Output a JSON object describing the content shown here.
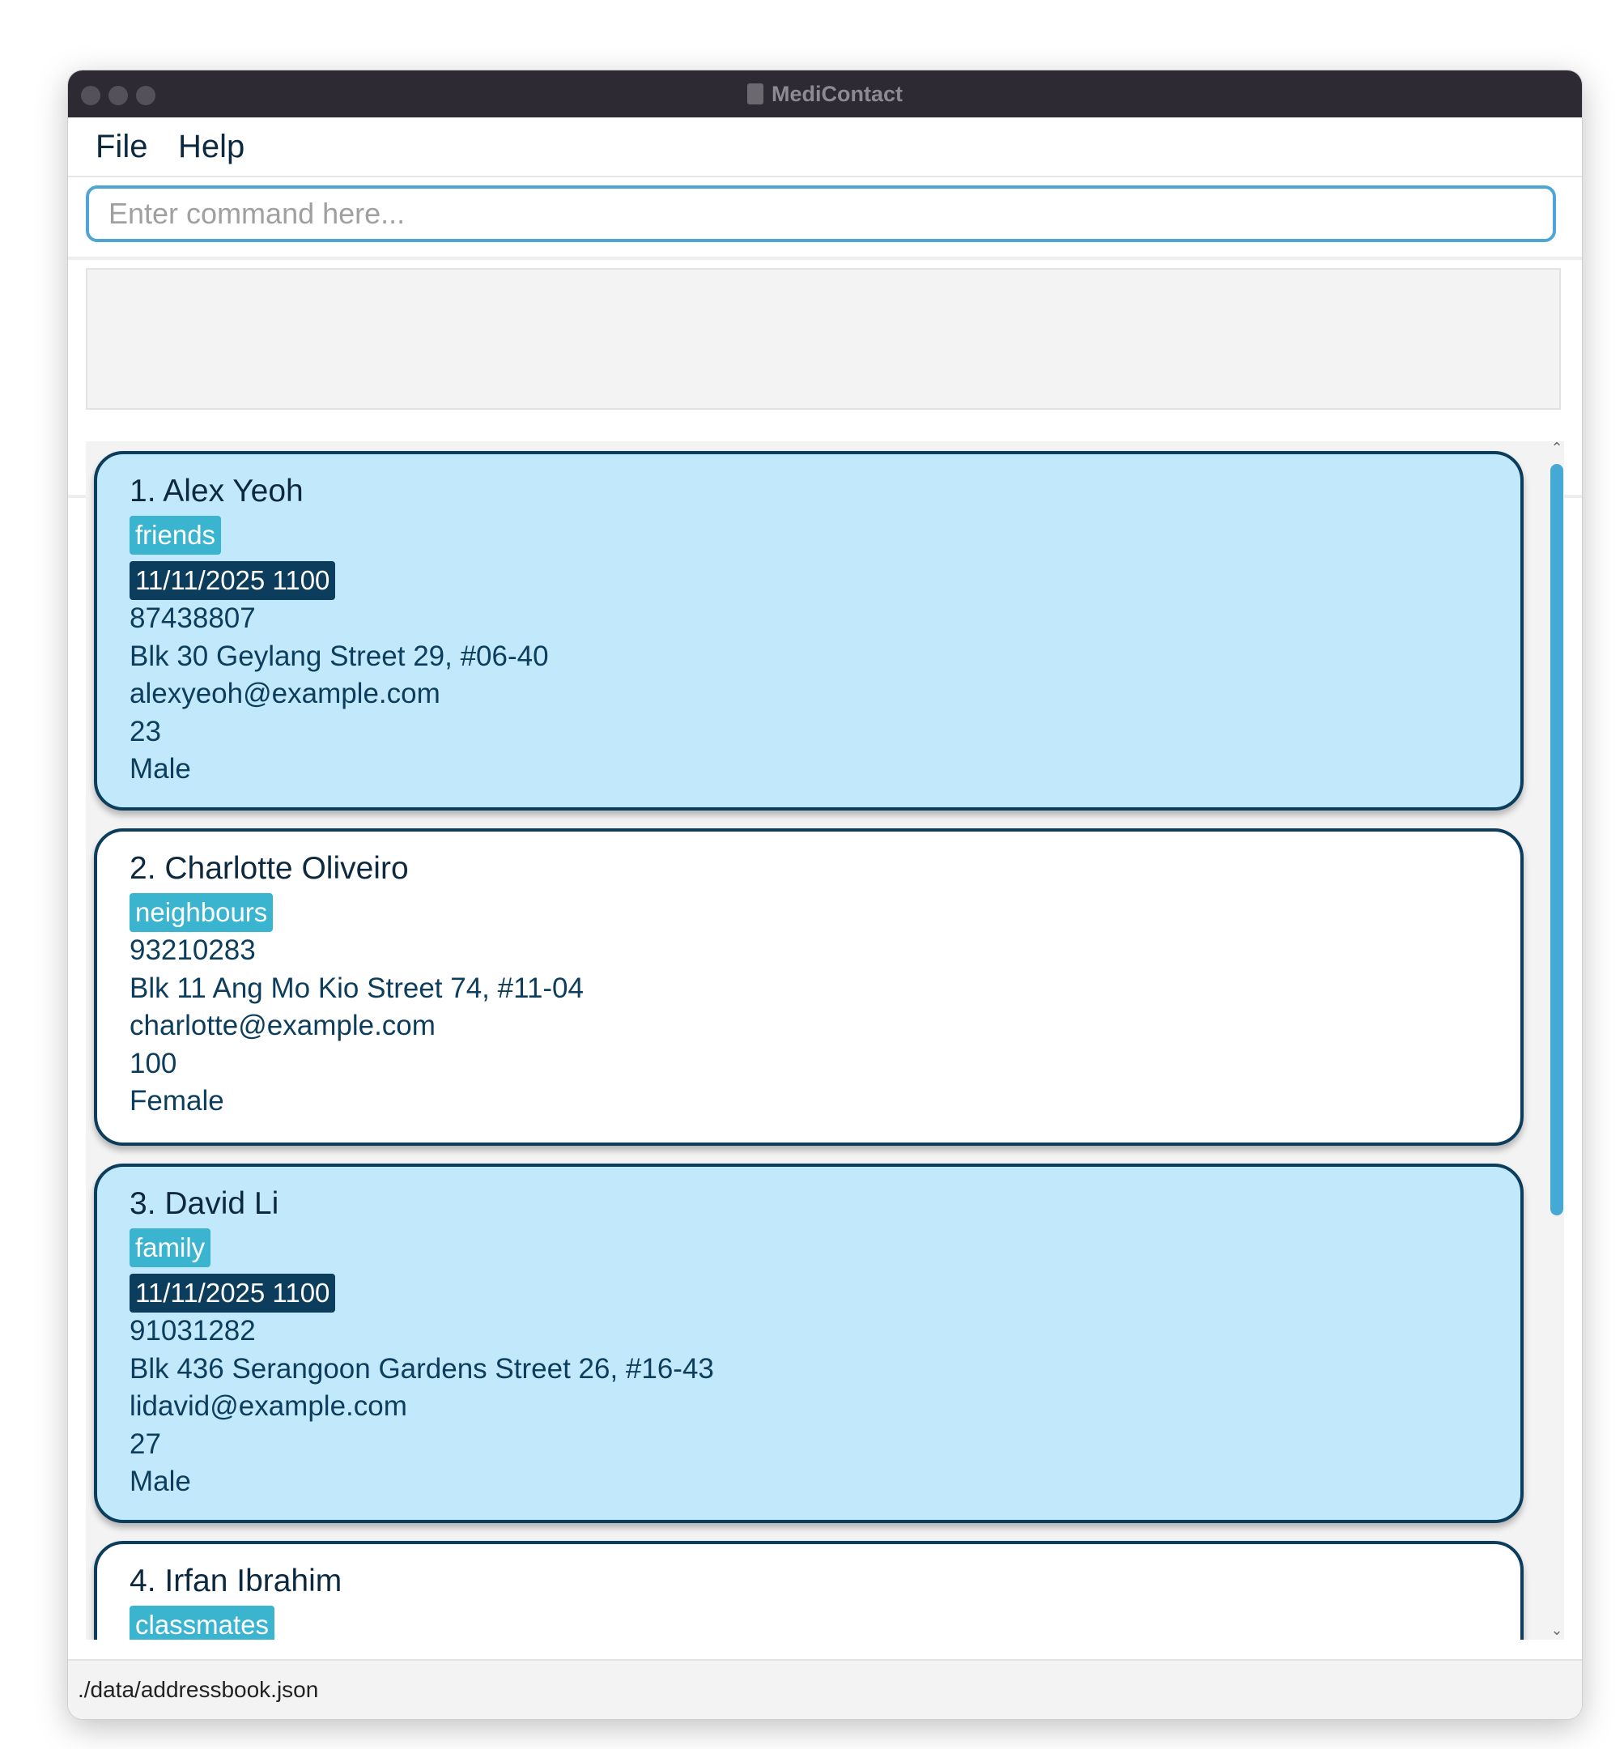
{
  "window": {
    "title": "MediContact",
    "title_icon": "app-icon"
  },
  "menu": {
    "file": "File",
    "help": "Help"
  },
  "command": {
    "placeholder": "Enter command here...",
    "value": ""
  },
  "result": {
    "text": ""
  },
  "persons": [
    {
      "name": "1. Alex Yeoh",
      "tag": "friends",
      "appointment": "11/11/2025 1100",
      "phone": "87438807",
      "address": "Blk 30 Geylang Street 29, #06-40",
      "email": "alexyeoh@example.com",
      "age": "23",
      "gender": "Male",
      "selected": true
    },
    {
      "name": "2. Charlotte Oliveiro",
      "tag": "neighbours",
      "appointment": "",
      "phone": "93210283",
      "address": "Blk 11 Ang Mo Kio Street 74, #11-04",
      "email": "charlotte@example.com",
      "age": "100",
      "gender": "Female",
      "selected": false
    },
    {
      "name": "3. David Li",
      "tag": "family",
      "appointment": "11/11/2025 1100",
      "phone": "91031282",
      "address": "Blk 436 Serangoon Gardens Street 26, #16-43",
      "email": "lidavid@example.com",
      "age": "27",
      "gender": "Male",
      "selected": true
    },
    {
      "name": "4. Irfan Ibrahim",
      "tag": "classmates",
      "selected": false
    }
  ],
  "status": {
    "path": "./data/addressbook.json"
  },
  "colors": {
    "accent": "#45a9d8",
    "selected_card": "#c2e8fb",
    "tag": "#3ab4cf",
    "appointment_badge": "#0c3d5c",
    "titlebar": "#2e2a33"
  }
}
